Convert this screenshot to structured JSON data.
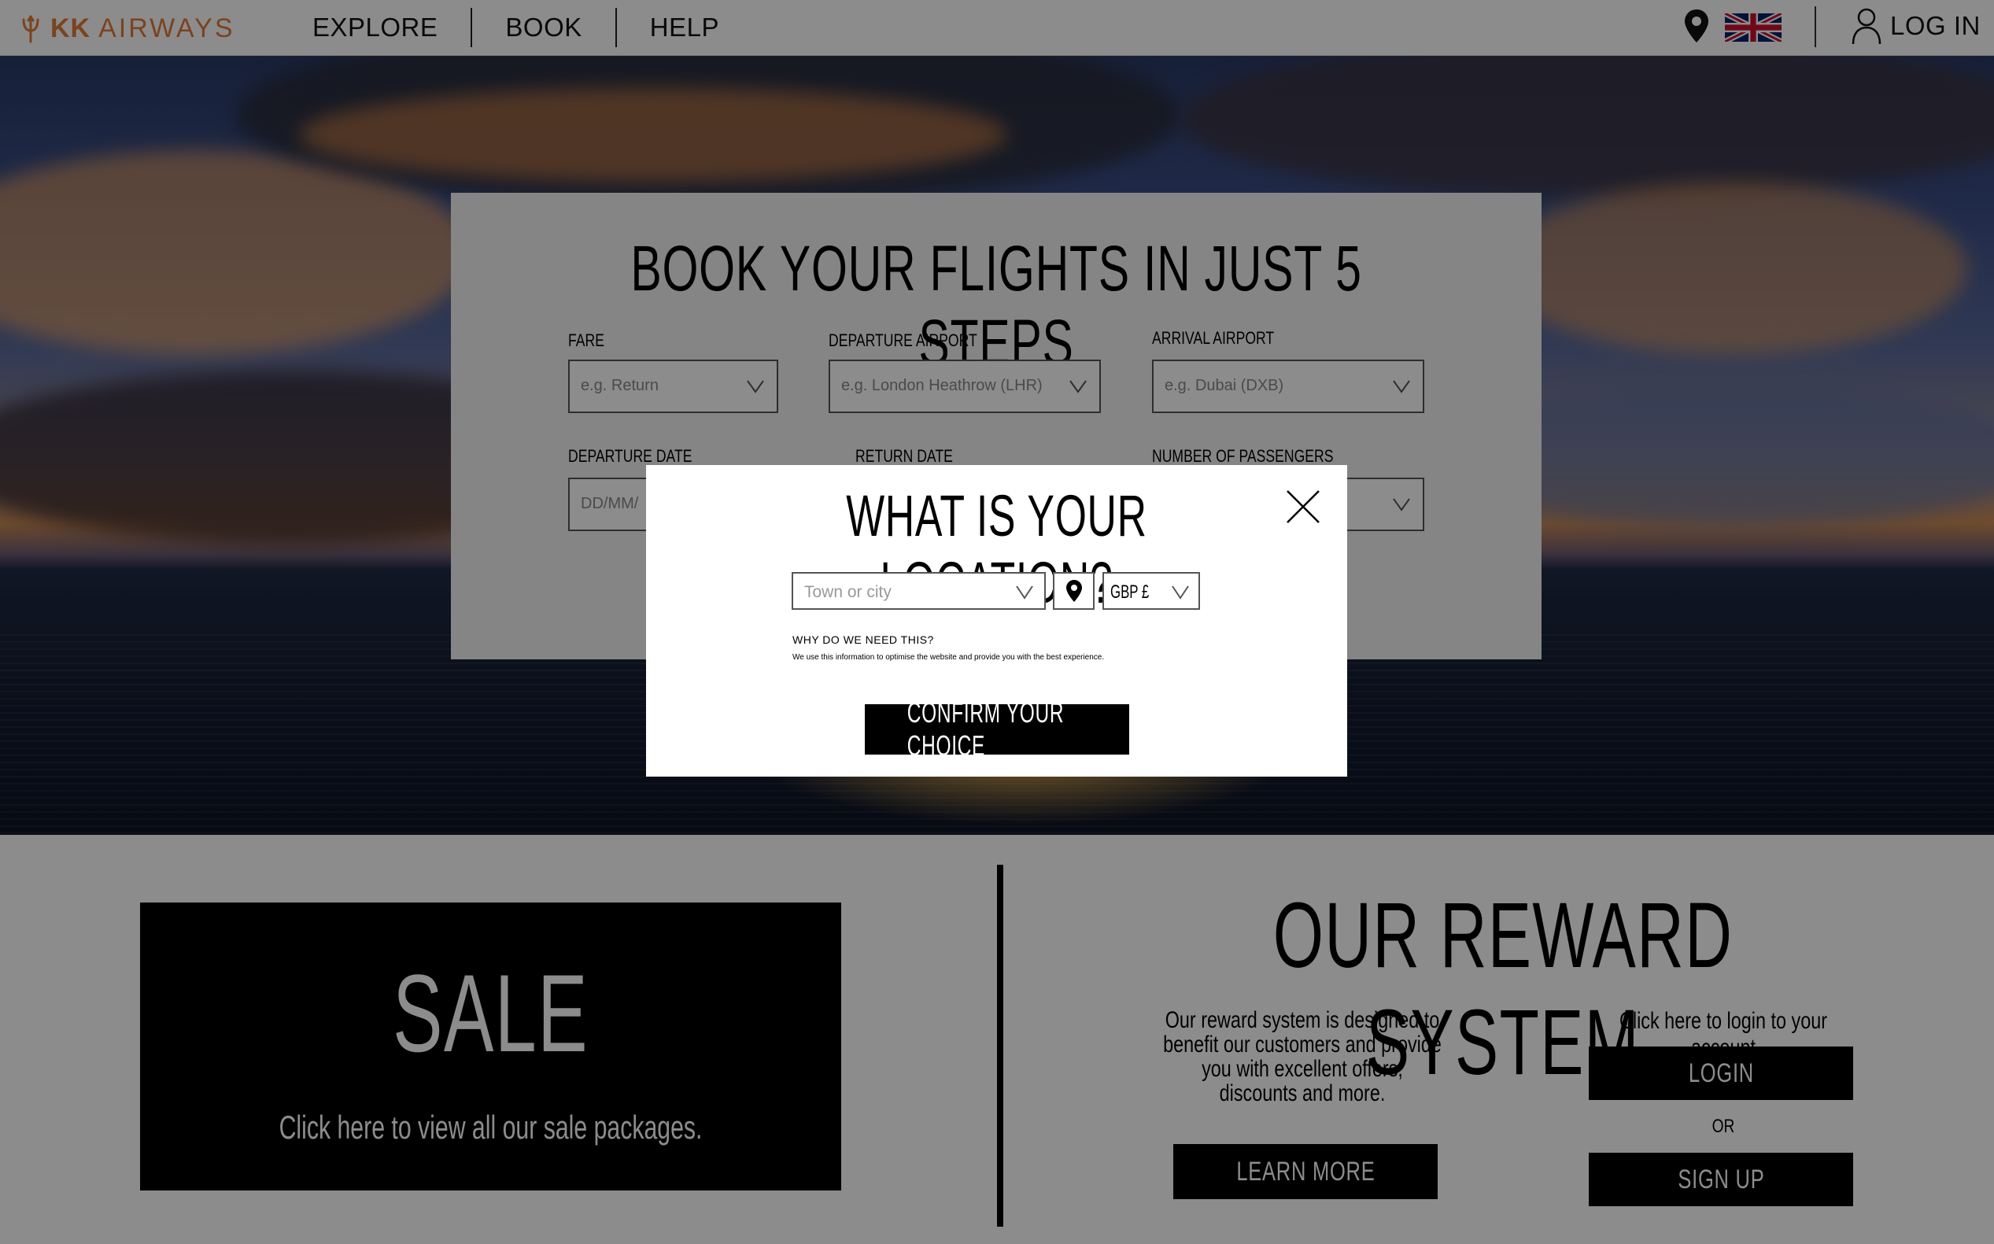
{
  "header": {
    "logo_bold": "KK",
    "logo_text": "AIRWAYS",
    "nav": [
      "EXPLORE",
      "BOOK",
      "HELP"
    ],
    "login_label": "LOG IN",
    "brand_color": "#e07a3a"
  },
  "booking": {
    "title": "BOOK YOUR FLIGHTS IN JUST 5 STEPS",
    "fields": {
      "fare": {
        "label": "FARE",
        "placeholder": "e.g. Return"
      },
      "departure_airport": {
        "label": "DEPARTURE AIRPORT",
        "placeholder": "e.g. London Heathrow (LHR)"
      },
      "arrival_airport": {
        "label": "ARRIVAL AIRPORT",
        "placeholder": "e.g. Dubai (DXB)"
      },
      "departure_date": {
        "label": "DEPARTURE DATE",
        "placeholder": "DD/MM/"
      },
      "return_date": {
        "label": "RETURN DATE"
      },
      "passengers": {
        "label": "NUMBER OF PASSENGERS"
      }
    }
  },
  "modal": {
    "title": "WHAT IS YOUR LOCATION?",
    "city_placeholder": "Town or city",
    "currency": "GBP £",
    "why_title": "WHY DO WE NEED THIS?",
    "why_text": "We use this information to optimise the website and provide you with the best experience.",
    "confirm_label": "CONFIRM YOUR CHOICE"
  },
  "sale": {
    "title": "SALE",
    "text": "Click here to view all our sale packages."
  },
  "rewards": {
    "title": "OUR REWARD SYSTEM",
    "description": "Our reward system is designed to benefit our customers and provide you with  excellent offers, discounts and more.",
    "learn_more": "LEARN MORE",
    "login_prompt": "Click here to login to your account",
    "login": "LOGIN",
    "or": "OR",
    "signup": "SIGN UP"
  }
}
